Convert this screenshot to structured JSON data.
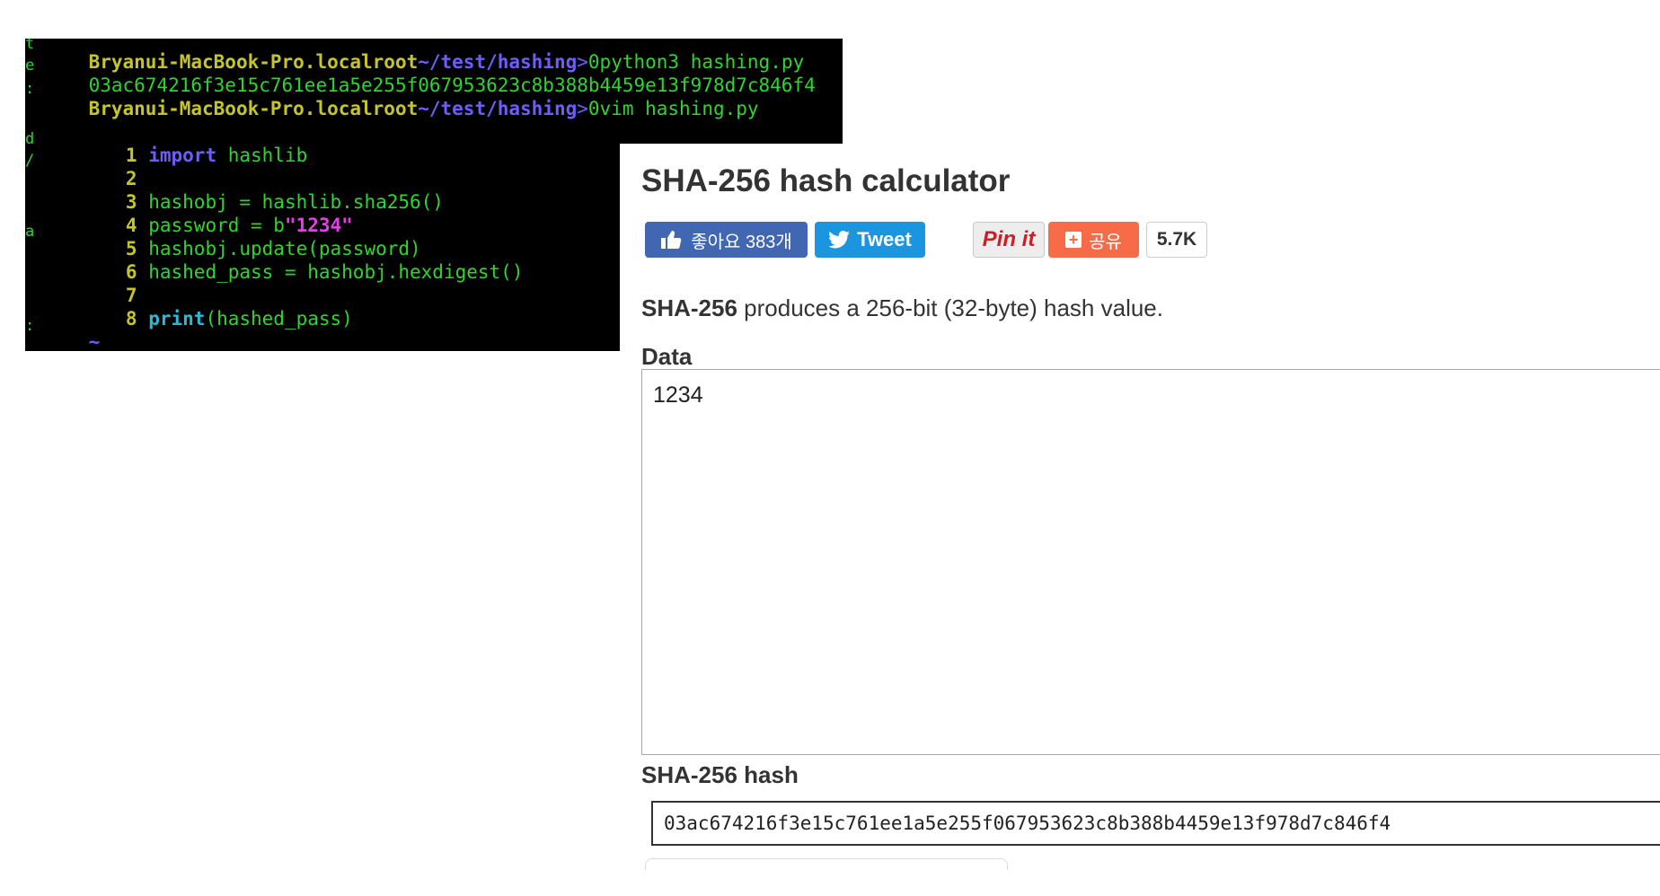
{
  "terminal": {
    "gutter_chars": [
      "t",
      "e",
      ":",
      "",
      "d",
      "/",
      "",
      "a",
      "",
      ":",
      ""
    ],
    "line1": {
      "host": "Bryanui-MacBook-Pro.localroot",
      "path": "~/test/hashing",
      "gt": ">",
      "command": "0python3 hashing.py"
    },
    "output": "03ac674216f3e15c761ee1a5e255f067953623c8b388b4459e13f978d7c846f4",
    "line3": {
      "host": "Bryanui-MacBook-Pro.localroot",
      "path": "~/test/hashing",
      "gt": ">",
      "command": "0vim hashing.py"
    },
    "code_lines": [
      {
        "num": "1",
        "keyword": "import",
        "text": " hashlib"
      },
      {
        "num": "2",
        "text": ""
      },
      {
        "num": "3",
        "text": "hashobj = hashlib.sha256()"
      },
      {
        "num": "4",
        "pre": "password = b",
        "str": "\"1234\""
      },
      {
        "num": "5",
        "text": "hashobj.update(password)"
      },
      {
        "num": "6",
        "text": "hashed_pass = hashobj.hexdigest()"
      },
      {
        "num": "7",
        "text": ""
      },
      {
        "num": "8",
        "keyword": "print",
        "text": "(hashed_pass)"
      }
    ],
    "tilde": "~",
    "colors": {
      "background": "#000000",
      "green": "#2fd52f",
      "yellow": "#c5c52a",
      "purple": "#6e5cff",
      "magenta": "#e63de6",
      "cyan": "#2bbad6"
    }
  },
  "calculator": {
    "title": "SHA-256 hash calculator",
    "share": {
      "like_label": "좋아요 383개",
      "like_icon": "thumbs-up-icon",
      "tweet_label": "Tweet",
      "tweet_icon": "twitter-bird-icon",
      "pinit_label": "Pin it",
      "add_share_label": "공유",
      "add_icon": "plus-icon",
      "share_count": "5.7K"
    },
    "description_bold": "SHA-256",
    "description_rest": " produces a 256-bit (32-byte) hash value.",
    "data_label": "Data",
    "data_value": "1234",
    "hash_label": "SHA-256 hash",
    "hash_value": "03ac674216f3e15c761ee1a5e255f067953623c8b388b4459e13f978d7c846f4",
    "colors": {
      "facebook": "#4267b2",
      "twitter": "#1b95e0",
      "pinterest": "#cb2027",
      "addthis": "#f86b49",
      "text": "#333333"
    }
  }
}
